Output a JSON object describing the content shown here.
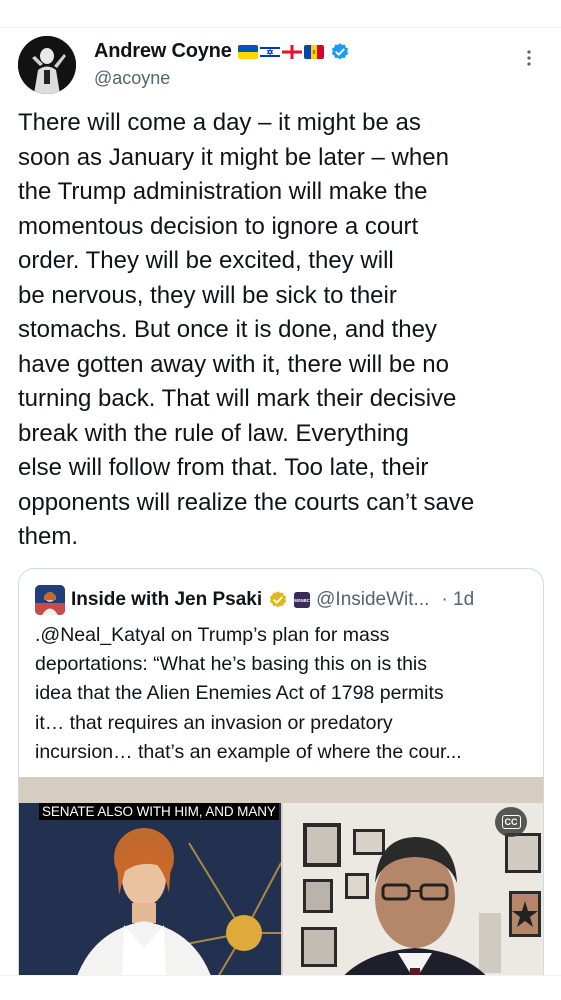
{
  "tweet": {
    "author": {
      "display_name": "Andrew Coyne",
      "handle": "@acoyne",
      "verified": true,
      "flags": [
        "ukraine-flag",
        "israel-flag",
        "georgia-flag",
        "moldova-flag"
      ]
    },
    "text": "There will come a day – it might be as\nsoon as January it might be later – when\nthe Trump administration will make the\nmomentous decision to ignore a court\norder. They will be excited, they will\nbe nervous, they will be sick to their\nstomachs. But once it is done, and they\nhave gotten away with it, there will be no\nturning back. That will mark their decisive\nbreak with the rule of law. Everything\nelse will follow from that. Too late, their\nopponents will realize the courts can’t save\nthem."
  },
  "quote": {
    "display_name": "Inside with Jen Psaki",
    "handle": "@InsideWit...",
    "time": "· 1d",
    "affiliate_label": "MSNBC",
    "text": ".@Neal_Katyal on Trump’s plan for mass\ndeportations: “What he’s basing this on is this\nidea that the Alien Enemies Act of 1798 permits\nit… that requires an invasion or predatory\nincursion… that’s an example of where the cour...",
    "video": {
      "caption": "SENATE ALSO WITH HIM, AND MANY",
      "cc_label": "CC"
    }
  },
  "colors": {
    "text_primary": "#0f1419",
    "text_secondary": "#536471",
    "verified_blue": "#1d9bf0",
    "verified_gold": "#e2b719",
    "border": "#cfd9de"
  }
}
